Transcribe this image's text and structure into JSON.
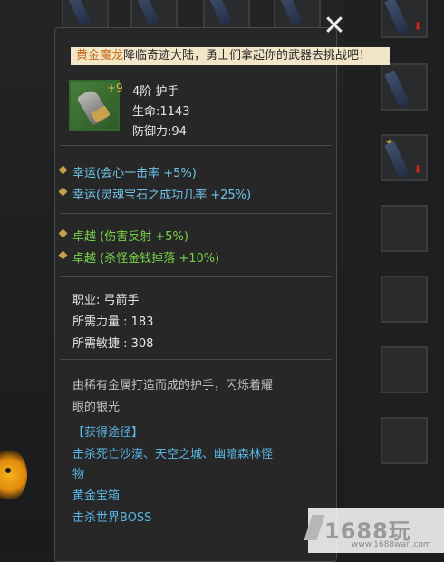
{
  "banner": {
    "highlight": "黄金魔龙",
    "text": "降临奇迹大陆，勇士们拿起你的武器去挑战吧！"
  },
  "item": {
    "level_plus": "+9",
    "name": "4阶 护手",
    "hp": "生命:1143",
    "defense": "防御力:94",
    "icon": "gauntlet-icon"
  },
  "luck_attrs": [
    "幸运(会心一击率 +5%)",
    "幸运(灵魂宝石之成功几率 +25%)"
  ],
  "excellent_attrs": [
    "卓越 (伤害反射 +5%)",
    "卓越 (杀怪金钱掉落 +10%)"
  ],
  "requirements": {
    "class": "职业: 弓箭手",
    "strength": "所需力量 : 183",
    "agility": "所需敏捷 : 308"
  },
  "description": {
    "line1": "由稀有金属打造而成的护手，闪烁着耀",
    "line2": "眼的银光"
  },
  "source": {
    "header": "【获得途径】",
    "line1": "击杀死亡沙漠、天空之城、幽暗森林怪",
    "line2": "物",
    "line3": "黄金宝箱",
    "line4": "击杀世界BOSS"
  },
  "watermark": {
    "text": "1688玩",
    "url": "www.1688wan.com"
  },
  "colors": {
    "luck": "#6fc3e9",
    "excellent": "#77d24a",
    "link": "#58b6e4",
    "banner_bg": "#f2e6c9",
    "banner_highlight": "#c86e17"
  }
}
